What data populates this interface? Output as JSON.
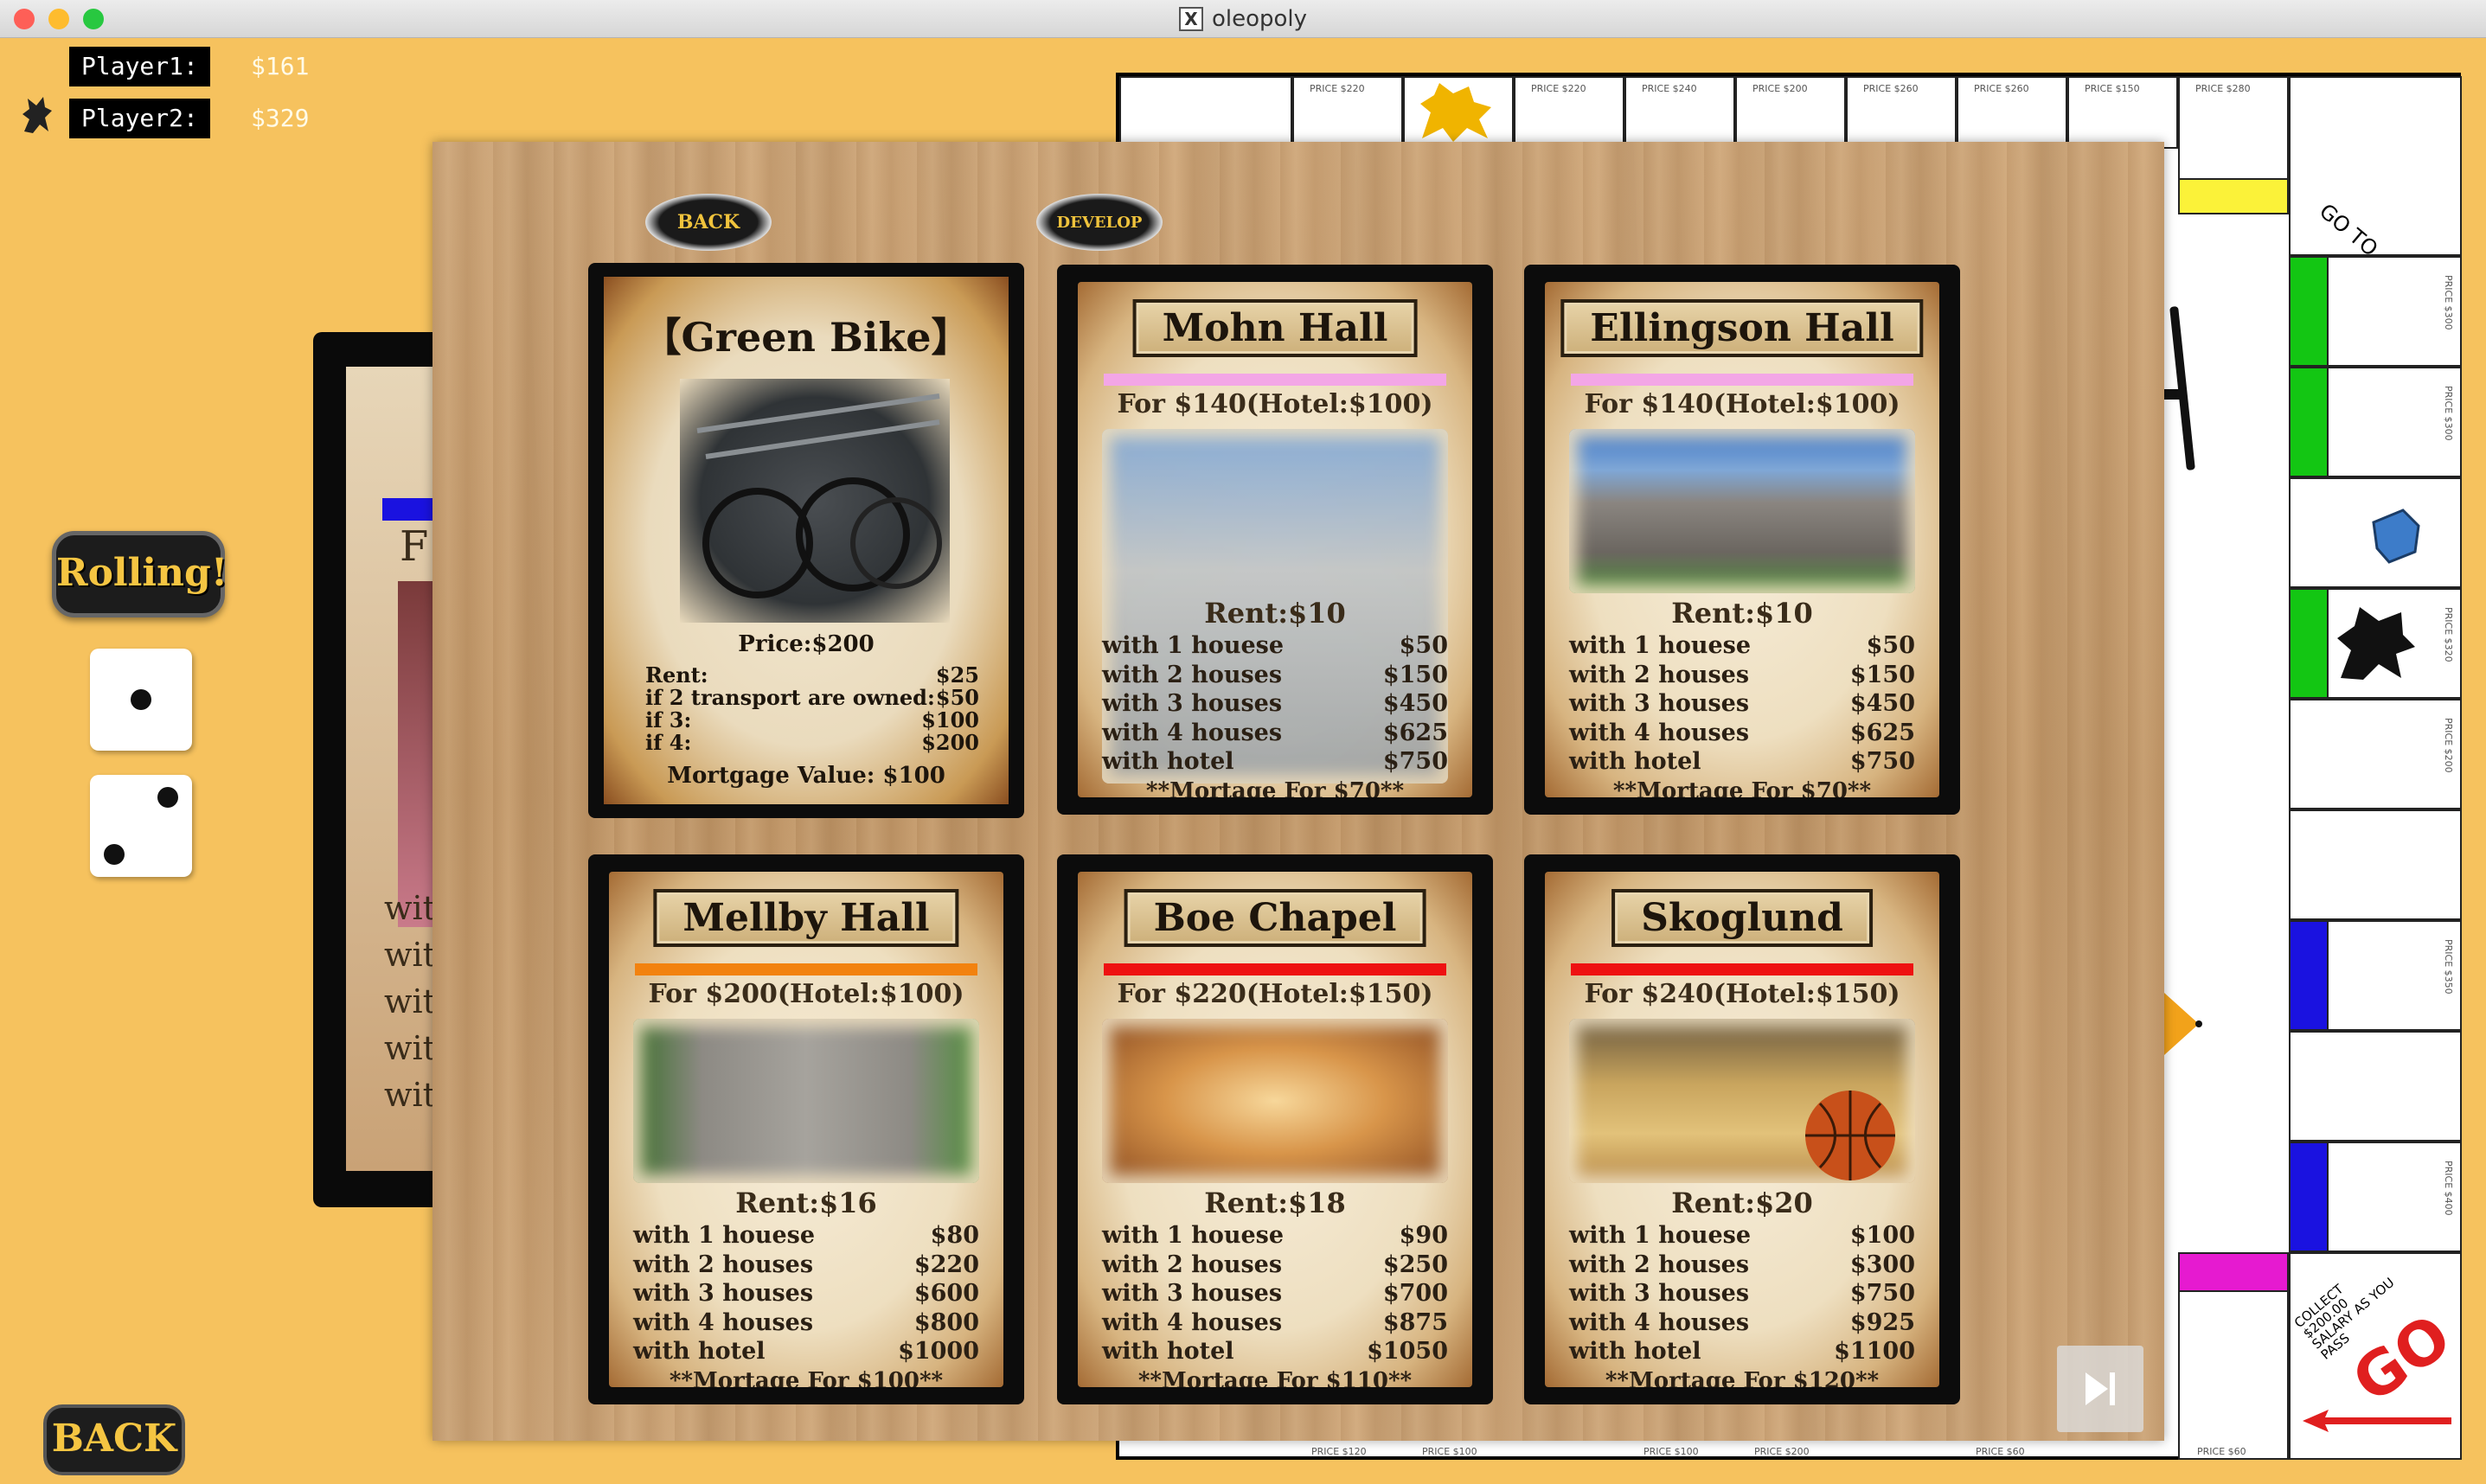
{
  "window": {
    "title": "oleopoly"
  },
  "players": [
    {
      "label": "Player1:",
      "money": "$161"
    },
    {
      "label": "Player2:",
      "money": "$329"
    }
  ],
  "controls": {
    "rolling_label": "Rolling!",
    "back_label": "BACK"
  },
  "dice": [
    1,
    2
  ],
  "overlay": {
    "back_label": "BACK",
    "develop_label": "DEVELOP",
    "skip_icon": "skip-forward-icon"
  },
  "background_card": {
    "visible_row_prefix": [
      "wit",
      "wit",
      "wit",
      "wit",
      "wit"
    ],
    "title_fragment": "F"
  },
  "transport_card": {
    "title": "【Green Bike】",
    "price": "Price:$200",
    "rows": [
      {
        "label": "Rent:",
        "value": "$25"
      },
      {
        "label": "if 2 transport are owned:",
        "value": "$50"
      },
      {
        "label": "if 3:",
        "value": "$100"
      },
      {
        "label": "if 4:",
        "value": "$200"
      }
    ],
    "mortgage": "Mortgage Value: $100"
  },
  "property_cards": [
    {
      "title": "Mohn Hall",
      "color": "#f3a6e6",
      "price": "For $140(Hotel:$100)",
      "rent": "Rent:$10",
      "rows": [
        {
          "label": "with 1 houese",
          "value": "$50"
        },
        {
          "label": "with 2 houses",
          "value": "$150"
        },
        {
          "label": "with 3 houses",
          "value": "$450"
        },
        {
          "label": "with 4 houses",
          "value": "$625"
        },
        {
          "label": "with hotel",
          "value": "$750"
        }
      ],
      "mortgage": "**Mortage For $70**"
    },
    {
      "title": "Ellingson Hall",
      "color": "#f3a6e6",
      "price": "For $140(Hotel:$100)",
      "rent": "Rent:$10",
      "rows": [
        {
          "label": "with 1 houese",
          "value": "$50"
        },
        {
          "label": "with 2 houses",
          "value": "$150"
        },
        {
          "label": "with 3 houses",
          "value": "$450"
        },
        {
          "label": "with 4 houses",
          "value": "$625"
        },
        {
          "label": "with hotel",
          "value": "$750"
        }
      ],
      "mortgage": "**Mortage For $70**"
    },
    {
      "title": "Mellby Hall",
      "color": "#f2820f",
      "price": "For $200(Hotel:$100)",
      "rent": "Rent:$16",
      "rows": [
        {
          "label": "with 1 houese",
          "value": "$80"
        },
        {
          "label": "with 2 houses",
          "value": "$220"
        },
        {
          "label": "with 3 houses",
          "value": "$600"
        },
        {
          "label": "with 4 houses",
          "value": "$800"
        },
        {
          "label": "with hotel",
          "value": "$1000"
        }
      ],
      "mortgage": "**Mortage For $100**"
    },
    {
      "title": "Boe Chapel",
      "color": "#ee1111",
      "price": "For $220(Hotel:$150)",
      "rent": "Rent:$18",
      "rows": [
        {
          "label": "with 1 houese",
          "value": "$90"
        },
        {
          "label": "with 2 houses",
          "value": "$250"
        },
        {
          "label": "with 3 houses",
          "value": "$700"
        },
        {
          "label": "with 4 houses",
          "value": "$875"
        },
        {
          "label": "with hotel",
          "value": "$1050"
        }
      ],
      "mortgage": "**Mortage For $110**"
    },
    {
      "title": "Skoglund",
      "color": "#ee1111",
      "price": "For $240(Hotel:$150)",
      "rent": "Rent:$20",
      "rows": [
        {
          "label": "with 1 houese",
          "value": "$100"
        },
        {
          "label": "with 2 houses",
          "value": "$300"
        },
        {
          "label": "with 3 houses",
          "value": "$750"
        },
        {
          "label": "with 4 houses",
          "value": "$925"
        },
        {
          "label": "with hotel",
          "value": "$1100"
        }
      ],
      "mortgage": "**Mortage For $120**"
    }
  ],
  "board": {
    "go_to_label": "GO TO",
    "go_label": "GO",
    "collect_text": "COLLECT $200.00 SALARY AS YOU PASS",
    "top_prices": [
      "PRICE $220",
      "PRICE $220",
      "PRICE $240",
      "PRICE $200",
      "PRICE $260",
      "PRICE $260",
      "PRICE $150",
      "PRICE $280"
    ],
    "right_prices": [
      "PRICE $300",
      "PRICE $300",
      "PRICE $320",
      "PRICE $200",
      "PRICE $350",
      "PRICE $400"
    ],
    "bottom_prices": [
      "PRICE $120",
      "PRICE $100",
      "PRICE $100",
      "PRICE $200",
      "PRICE $60",
      "PRICE $60"
    ]
  }
}
